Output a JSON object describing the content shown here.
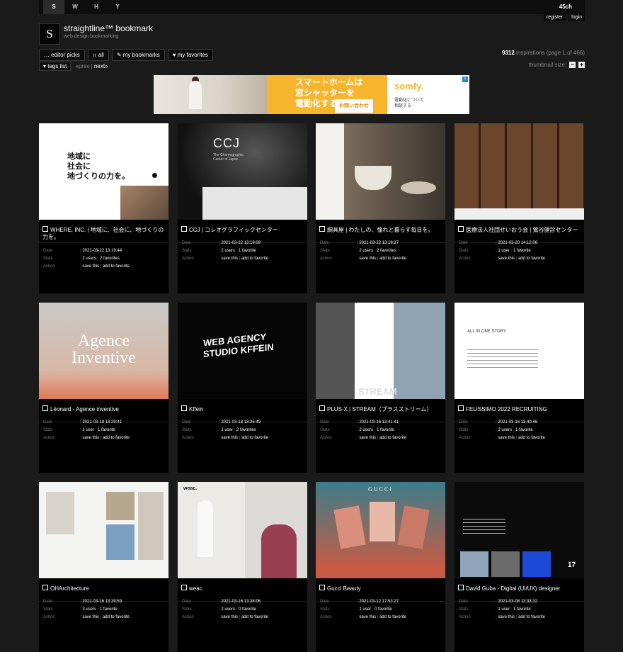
{
  "topbar": {
    "letters": [
      "S",
      "W",
      "H",
      "Y"
    ],
    "right_label": "45ch"
  },
  "header": {
    "logo_letter": "S",
    "title": "straightline™  bookmark",
    "subtitle": "web design bookmarking",
    "register": "register",
    "login": "login"
  },
  "nav": {
    "editor_picks": "editor picks",
    "all": "all",
    "my_bookmarks": "my bookmarks",
    "my_favorites": "my favorites",
    "count": "9312",
    "count_suffix": " inspirations (page 1 of 466)",
    "tags_list": "tags list",
    "prev": "«prev",
    "next": "next»",
    "thumb_label": "thumbnail size:"
  },
  "ad": {
    "headline_1": "スマートホームは",
    "headline_2": "窓シャッターを",
    "headline_3": "電動化する",
    "cta": "お問い合わせ",
    "brand": "somfy.",
    "side_1": "電動化について",
    "side_2": "相談する"
  },
  "meta_labels": {
    "date": "Date",
    "stats": "Stats",
    "action": "Action"
  },
  "cards": [
    {
      "title": "WHERE, INC. | 地域に、社会に、地づくりの力を。",
      "date": ": 2021-03-22 13:19:44",
      "stats_a": "2 users",
      "stats_b": "2 favorites",
      "act_a": "save this",
      "act_b": "add to favorite"
    },
    {
      "title": "CCJ | コレオグラフィックセンター",
      "date": ": 2021-03-22 13:19:09",
      "stats_a": "2 users",
      "stats_b": "1 favorite",
      "act_a": "save this",
      "act_b": "add to favorite"
    },
    {
      "title": "綱具屋 | わたしの、憧れと暮らす毎日を。",
      "date": ": 2021-03-22 13:18:37",
      "stats_a": "2 users",
      "stats_b": "2 favorites",
      "act_a": "save this",
      "act_b": "add to favorite"
    },
    {
      "title": "医療法人社団せいおう会 | 鶯谷健診センター",
      "date": ": 2021-03-20 14:12:06",
      "stats_a": "1 user",
      "stats_b": "1 favorite",
      "act_a": "save this",
      "act_b": "add to favorite"
    },
    {
      "title": "Léonard - Agence inventive",
      "date": ": 2021-03-18 13:29:41",
      "stats_a": "1 user",
      "stats_b": "1 favorite",
      "act_a": "save this",
      "act_b": "add to favorite"
    },
    {
      "title": "Kffein",
      "date": ": 2021-03-18 13:26:49",
      "stats_a": "1 user",
      "stats_b": "2 favorites",
      "act_a": "save this",
      "act_b": "add to favorite"
    },
    {
      "title": "PLUS-X | STREAM（プラスストリーム）",
      "date": ": 2021-03-16 13:41:41",
      "stats_a": "2 users",
      "stats_b": "1 favorite",
      "act_a": "save this",
      "act_b": "add to favorite"
    },
    {
      "title": "FELISSIMO 2022 RECRUITING",
      "date": ": 2021-03-16 13:40:46",
      "stats_a": "2 users",
      "stats_b": "1 favorite",
      "act_a": "save this",
      "act_b": "add to favorite"
    },
    {
      "title": "OHArchitecture",
      "date": ": 2021-03-16 13:39:59",
      "stats_a": "3 users",
      "stats_b": "1 favorite",
      "act_a": "save this",
      "act_b": "add to favorite"
    },
    {
      "title": "weac.",
      "date": ": 2021-03-16 13:38:06",
      "stats_a": "2 users",
      "stats_b": "0 favorite",
      "act_a": "save this",
      "act_b": "add to favorite"
    },
    {
      "title": "Gucci Beauty",
      "date": ": 2021-03-12 17:53:27",
      "stats_a": "1 user",
      "stats_b": "0 favorite",
      "act_a": "save this",
      "act_b": "add to favorite"
    },
    {
      "title": "David Guba - Digital (UI/UX) designer",
      "date": ": 2021-03-08 13:33:32",
      "stats_a": "1 user",
      "stats_b": "1 favorite",
      "act_a": "save this",
      "act_b": "add to favorite"
    }
  ],
  "thumb_texts": {
    "where": "地域に\n社会に\n地づくりの力を。",
    "ccj_big": "CCJ",
    "ccj_small": "The Choreographic Center of Japan",
    "agence_1": "Agence",
    "agence_2": "Inventive",
    "kffein": "WEB AGENCY",
    "kffein_2": "STUDIO KFFEIN",
    "felissimo": "ALL IN ONE STORY",
    "weac": "weac.",
    "gucci": "GUCCI",
    "plusx_stream": "STREAM",
    "david_num": "17"
  }
}
